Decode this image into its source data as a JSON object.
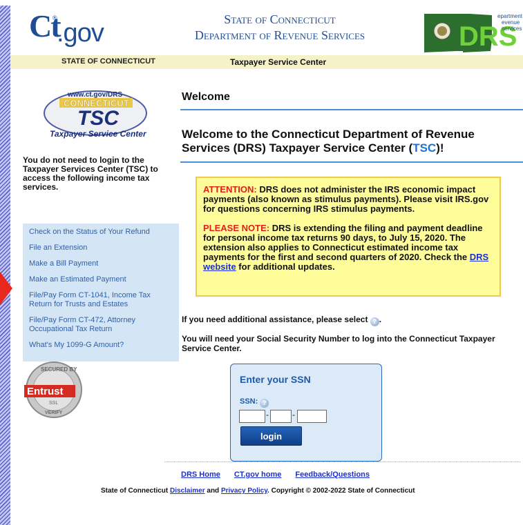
{
  "header": {
    "logo_text": "Ct.gov",
    "title_line1": "State of Connecticut",
    "title_line2": "Department of Revenue Services",
    "drs_logo_text": "DRS",
    "drs_logo_sub": "department of revenue services",
    "subbar_left": "STATE OF CONNECTICUT",
    "subbar_right": "Taxpayer Service Center"
  },
  "sidebar": {
    "logo_url_text": "www.ct.gov/DRS",
    "logo_state_text": "CONNECTICUT",
    "logo_tsc": "TSC",
    "logo_caption": "Taxpayer Service Center",
    "intro": "You do not need to login to the Taxpayer Services Center (TSC) to access the following income tax services.",
    "items": [
      {
        "label": "Check on the Status of Your Refund"
      },
      {
        "label": "File an Extension"
      },
      {
        "label": "Make a Bill Payment"
      },
      {
        "label": "Make an Estimated Payment"
      },
      {
        "label": "File/Pay Form CT-1041, Income Tax Return for Trusts and Estates"
      },
      {
        "label": "File/Pay Form CT-472, Attorney Occupational Tax Return"
      },
      {
        "label": "What's My 1099-G Amount?"
      }
    ],
    "seal_text": "Entrust",
    "seal_top": "SECURED BY",
    "seal_bottom": "VERIFY",
    "seal_mid": "SSL"
  },
  "main": {
    "welcome_heading": "Welcome",
    "welcome_big_prefix": "Welcome to the Connecticut Department of Revenue Services (DRS) Taxpayer Service Center (",
    "welcome_big_tsc": "TSC",
    "welcome_big_suffix": ")!",
    "notice": {
      "attention_label": "ATTENTION:",
      "attention_text": " DRS does not administer the IRS economic impact payments (also known as stimulus payments). Please visit IRS.gov for questions concerning IRS stimulus payments.",
      "please_label": "PLEASE NOTE:",
      "please_text": " DRS is extending the filing and payment deadline for personal income tax returns 90 days, to July 15, 2020. The extension also applies to Connecticut estimated income tax payments for the first and second quarters of 2020. Check the ",
      "link_text": "DRS website",
      "please_tail": " for additional updates."
    },
    "assist_text": "If you need additional assistance, please select",
    "assist_tail": ".",
    "ssn_note": "You will need your Social Security Number to log into the Connecticut Taxpayer Service Center.",
    "ssn_box": {
      "title": "Enter your SSN",
      "label": "SSN:",
      "part1": "",
      "part2": "",
      "part3": "",
      "login_label": "login"
    }
  },
  "footer": {
    "links": [
      "DRS Home",
      "CT.gov home",
      "Feedback/Questions"
    ],
    "copy_prefix": "State of Connecticut ",
    "disclaimer": "Disclaimer",
    "and": " and ",
    "privacy": "Privacy Policy",
    "copy_suffix": ". Copyright © 2002-2022 State of Connecticut"
  },
  "colors": {
    "brand_blue": "#1f4e96",
    "rule_blue": "#4a8fd6",
    "alert_red": "#e81b1b",
    "notice_bg": "#fffd99",
    "nav_bg": "#d4e6f6"
  }
}
